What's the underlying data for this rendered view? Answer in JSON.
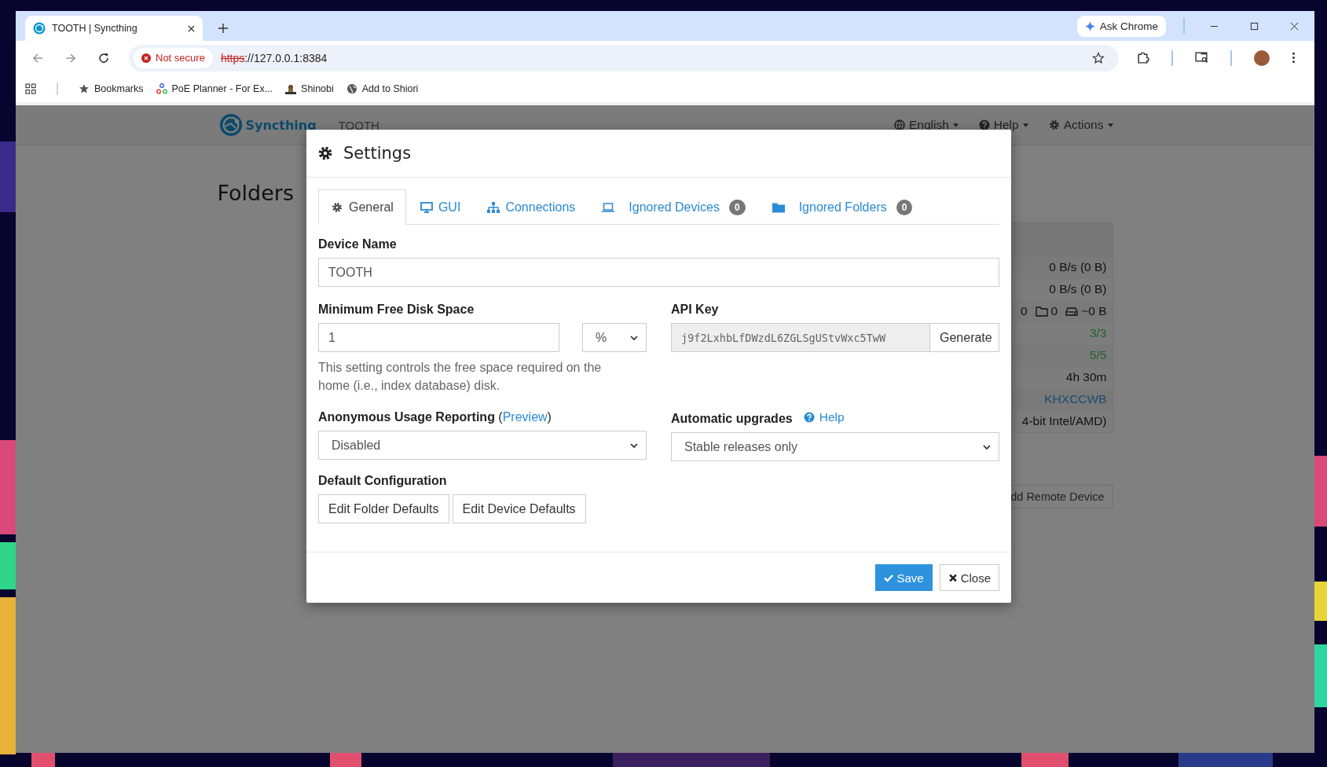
{
  "browser": {
    "tab_title": "TOOTH | Syncthing",
    "ask_chrome": "Ask Chrome",
    "security_label": "Not secure",
    "url_scheme": "https",
    "url_rest": "://127.0.0.1:8384",
    "bookmarks": [
      "Bookmarks",
      "PoE Planner - For Ex...",
      "Shinobi",
      "Add to Shiori"
    ]
  },
  "app": {
    "brand": "Syncthing",
    "device": "TOOTH",
    "menus": [
      "English",
      "Help",
      "Actions"
    ],
    "folders_heading": "Folders",
    "stats": [
      {
        "kind": "plain",
        "text": "0 B/s (0 B)"
      },
      {
        "kind": "plain",
        "text": "0 B/s (0 B)"
      },
      {
        "kind": "counts",
        "values": [
          "0",
          "0",
          "~0 B"
        ]
      },
      {
        "kind": "ok",
        "text": "3/3"
      },
      {
        "kind": "ok",
        "text": "5/5"
      },
      {
        "kind": "plain",
        "text": "4h 30m"
      },
      {
        "kind": "link",
        "text": "KHXCCWB"
      },
      {
        "kind": "plain",
        "text": "4-bit Intel/AMD)"
      }
    ],
    "add_device_button": "dd Remote Device"
  },
  "dialog": {
    "title": "Settings",
    "tabs": [
      {
        "label": "General",
        "selected": true
      },
      {
        "label": "GUI",
        "selected": false
      },
      {
        "label": "Connections",
        "selected": false
      },
      {
        "label": "Ignored Devices",
        "badge": "0",
        "selected": false
      },
      {
        "label": "Ignored Folders",
        "badge": "0",
        "selected": false
      }
    ],
    "device_name": {
      "label": "Device Name",
      "value": "TOOTH"
    },
    "min_free_disk": {
      "label": "Minimum Free Disk Space",
      "value": "1",
      "unit": "%",
      "help": "This setting controls the free space required on the home (i.e., index database) disk."
    },
    "api_key": {
      "label": "API Key",
      "value": "j9f2LxhbLfDWzdL6ZGLSgUStvWxc5TwW",
      "button": "Generate"
    },
    "usage_reporting": {
      "label": "Anonymous Usage Reporting",
      "paren_open": "(",
      "link": "Preview",
      "paren_close": ")",
      "value": "Disabled"
    },
    "auto_upgrades": {
      "label": "Automatic upgrades",
      "help": "Help",
      "value": "Stable releases only"
    },
    "default_config": {
      "label": "Default Configuration",
      "buttons": [
        "Edit Folder Defaults",
        "Edit Device Defaults"
      ]
    },
    "footer_buttons": [
      {
        "kind": "primary",
        "label": "Save"
      },
      {
        "kind": "default",
        "label": "Close"
      }
    ]
  }
}
